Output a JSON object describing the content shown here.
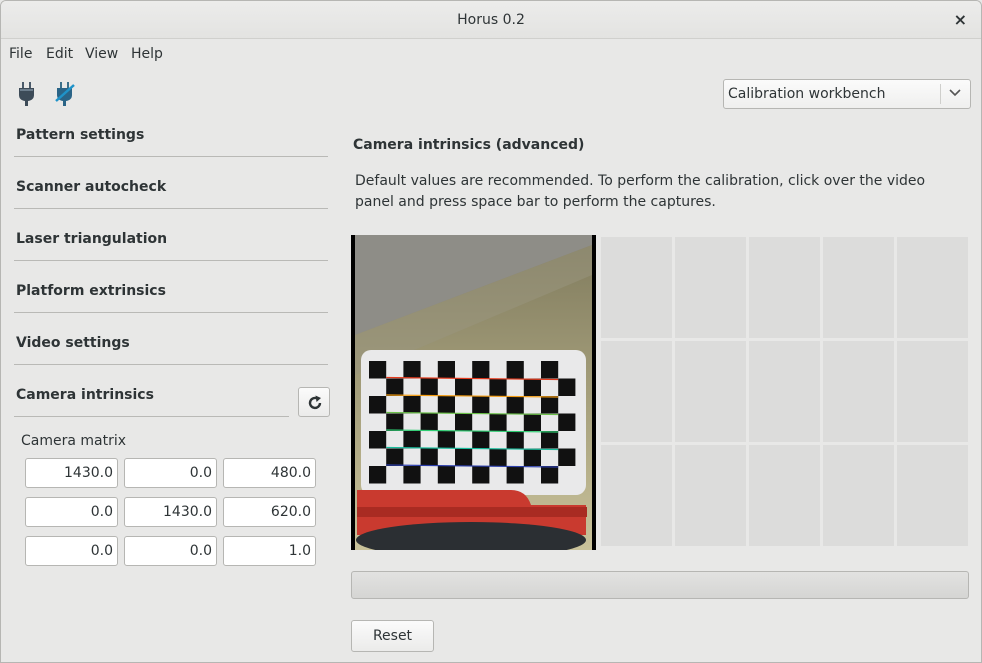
{
  "window": {
    "title": "Horus 0.2",
    "close_glyph": "×"
  },
  "menu": {
    "file": "File",
    "edit": "Edit",
    "view": "View",
    "help": "Help"
  },
  "toolbar": {
    "connect_icon": "plug-connect-icon",
    "disconnect_icon": "plug-disconnect-icon",
    "workbench_selected": "Calibration workbench"
  },
  "sidebar": {
    "sections": [
      {
        "label": "Pattern settings"
      },
      {
        "label": "Scanner autocheck"
      },
      {
        "label": "Laser triangulation"
      },
      {
        "label": "Platform extrinsics"
      },
      {
        "label": "Video settings"
      },
      {
        "label": "Camera intrinsics"
      }
    ],
    "refresh_icon": "refresh-icon",
    "camera_matrix_label": "Camera matrix",
    "camera_matrix": [
      [
        "1430.0",
        "0.0",
        "480.0"
      ],
      [
        "0.0",
        "1430.0",
        "620.0"
      ],
      [
        "0.0",
        "0.0",
        "1.0"
      ]
    ]
  },
  "main": {
    "title": "Camera intrinsics (advanced)",
    "description": "Default values are recommended. To perform the calibration, click over the video panel and press space bar to perform the captures.",
    "captures_taken": 0,
    "progress_percent": 0,
    "reset_label": "Reset"
  },
  "colors": {
    "background": "#e8e8e7",
    "thumb": "#dcdcdb",
    "border": "#b6b6b3"
  }
}
